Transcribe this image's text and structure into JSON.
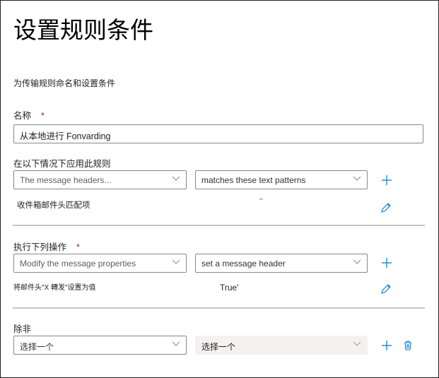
{
  "title": "设置规则条件",
  "subtitle": "为传输规则命名和设置条件",
  "name_field": {
    "label": "名称",
    "required": "*",
    "value": "从本地进行 Fonvarding"
  },
  "conditions": {
    "label": "在以下情况下应用此规则",
    "select1": "The message headers...",
    "select2": "matches these text patterns",
    "summary": "收件箱邮件头匹配项",
    "summary_value": "''"
  },
  "actions": {
    "label": "执行下列操作",
    "required": "*",
    "select1": "Modify the message properties",
    "select2": "set a message header",
    "summary": "将邮件头\"X 轉发\"设置为值",
    "summary_value": "True'"
  },
  "exceptions": {
    "label": "除非",
    "select1": "选择一个",
    "select2": "选择一个"
  },
  "colors": {
    "accent": "#0078d4",
    "required": "#a4262c",
    "divider": "#c8c6c4"
  }
}
